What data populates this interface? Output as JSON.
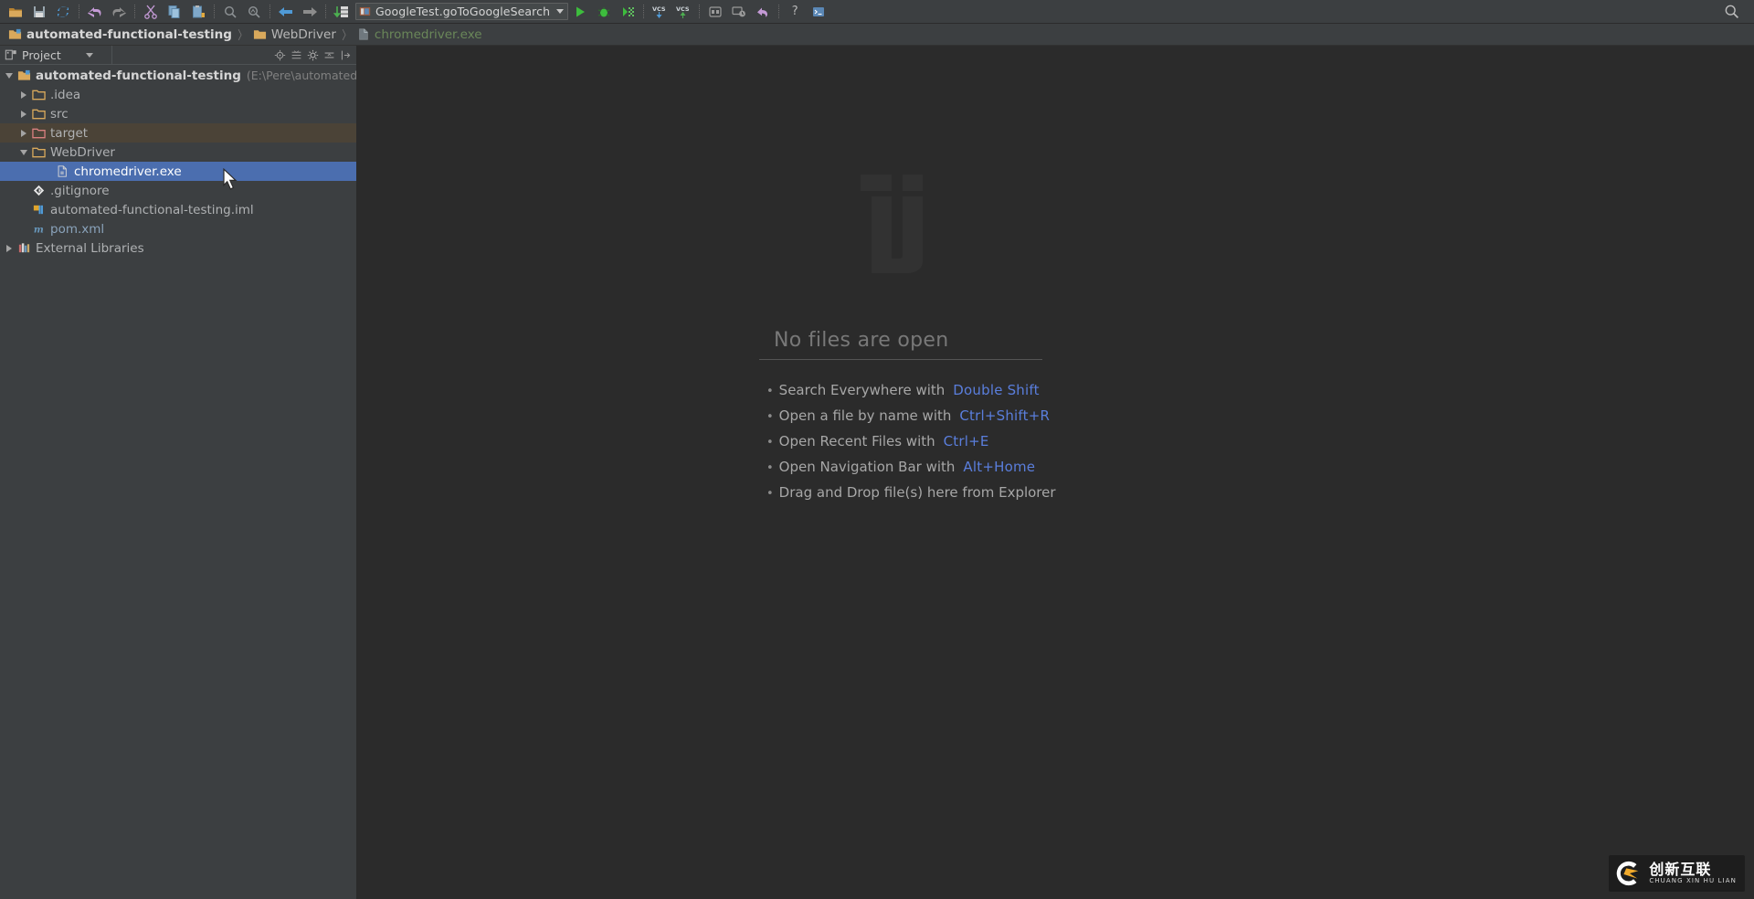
{
  "toolbar": {
    "icons": [
      {
        "name": "open-folder-icon",
        "title": "Open"
      },
      {
        "name": "save-all-icon",
        "title": "Save All"
      },
      {
        "name": "synchronize-icon",
        "title": "Synchronize"
      },
      {
        "name": "undo-icon",
        "title": "Undo"
      },
      {
        "name": "redo-icon",
        "title": "Redo"
      },
      {
        "name": "cut-icon",
        "title": "Cut"
      },
      {
        "name": "copy-icon",
        "title": "Copy"
      },
      {
        "name": "paste-icon",
        "title": "Paste"
      },
      {
        "name": "find-icon",
        "title": "Find"
      },
      {
        "name": "replace-icon",
        "title": "Replace"
      },
      {
        "name": "back-icon",
        "title": "Back"
      },
      {
        "name": "forward-icon",
        "title": "Forward"
      },
      {
        "name": "compile-icon",
        "title": "Build"
      },
      {
        "name": "run-icon",
        "title": "Run"
      },
      {
        "name": "debug-icon",
        "title": "Debug"
      },
      {
        "name": "run-with-coverage-icon",
        "title": "Run with Coverage"
      },
      {
        "name": "vcs-update-icon",
        "title": "Update Project"
      },
      {
        "name": "vcs-commit-icon",
        "title": "Commit"
      },
      {
        "name": "settings-icon",
        "title": "Settings"
      },
      {
        "name": "project-structure-icon",
        "title": "Project Structure"
      },
      {
        "name": "rollback-icon",
        "title": "Rollback"
      },
      {
        "name": "help-icon",
        "title": "Help"
      },
      {
        "name": "terminal-icon",
        "title": "Terminal"
      }
    ],
    "run_config": "GoogleTest.goToGoogleSearch",
    "help_label": "?",
    "search_icon": "search-icon"
  },
  "breadcrumb": {
    "separator": "〉",
    "items": [
      {
        "label": "automated-functional-testing",
        "icon": "project-folder-icon"
      },
      {
        "label": "WebDriver",
        "icon": "folder-icon"
      },
      {
        "label": "chromedriver.exe",
        "icon": "file-icon"
      }
    ]
  },
  "panel": {
    "title": "Project",
    "tools": [
      {
        "name": "locate-icon"
      },
      {
        "name": "expand-all-icon"
      },
      {
        "name": "gear-icon"
      },
      {
        "name": "collapse-icon"
      },
      {
        "name": "hide-icon"
      }
    ]
  },
  "tree": [
    {
      "label": "automated-functional-testing",
      "path": "(E:\\Pere\\automated-func",
      "icon": "project-folder-icon",
      "twisty": "down",
      "indent": 0,
      "state": "normal",
      "bold": true
    },
    {
      "label": ".idea",
      "path": "",
      "icon": "folder-icon",
      "twisty": "right",
      "indent": 1,
      "state": "normal",
      "bold": false
    },
    {
      "label": "src",
      "path": "",
      "icon": "folder-icon",
      "twisty": "right",
      "indent": 1,
      "state": "normal",
      "bold": false
    },
    {
      "label": "target",
      "path": "",
      "icon": "excluded-folder-icon",
      "twisty": "right",
      "indent": 1,
      "state": "hovered",
      "bold": false
    },
    {
      "label": "WebDriver",
      "path": "",
      "icon": "folder-icon",
      "twisty": "down",
      "indent": 1,
      "state": "normal",
      "bold": false
    },
    {
      "label": "chromedriver.exe",
      "path": "",
      "icon": "binary-file-icon",
      "twisty": "none",
      "indent": 2,
      "state": "selected",
      "bold": false
    },
    {
      "label": ".gitignore",
      "path": "",
      "icon": "gitignore-icon",
      "twisty": "none",
      "indent": 1,
      "state": "normal",
      "bold": false
    },
    {
      "label": "automated-functional-testing.iml",
      "path": "",
      "icon": "iml-module-icon",
      "twisty": "none",
      "indent": 1,
      "state": "normal",
      "bold": false
    },
    {
      "label": "pom.xml",
      "path": "",
      "icon": "maven-icon",
      "twisty": "none",
      "indent": 1,
      "state": "maven",
      "bold": false
    },
    {
      "label": "External Libraries",
      "path": "",
      "icon": "libraries-icon",
      "twisty": "right",
      "indent": 0,
      "state": "normal",
      "bold": false
    }
  ],
  "editor": {
    "empty_title": "No files are open",
    "tip_bullet": "•",
    "tips": [
      {
        "text": "Search Everywhere with",
        "key": "Double Shift"
      },
      {
        "text": "Open a file by name with",
        "key": "Ctrl+Shift+R"
      },
      {
        "text": "Open Recent Files with",
        "key": "Ctrl+E"
      },
      {
        "text": "Open Navigation Bar with",
        "key": "Alt+Home"
      },
      {
        "text": "Drag and Drop file(s) here from Explorer",
        "key": ""
      }
    ]
  },
  "brand": {
    "chinese": "创新互联",
    "pinyin": "CHUANG XIN HU LIAN"
  },
  "colors": {
    "accent_selection": "#4b6eaf",
    "hover_row": "#4b4337",
    "editor_bg": "#2b2b2b",
    "panel_bg": "#3c3f41",
    "key_hint": "#5a7edc",
    "crumb_file": "#6a8759"
  }
}
